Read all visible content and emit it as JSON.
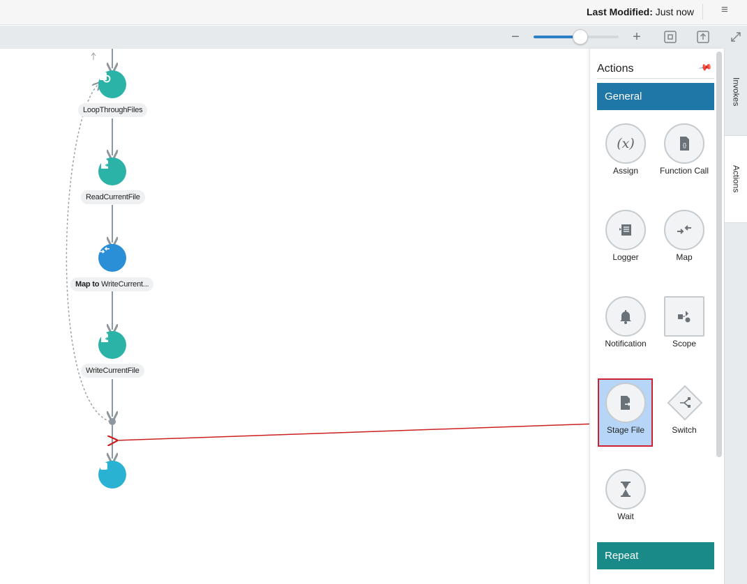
{
  "header": {
    "last_modified_label": "Last Modified:",
    "last_modified_value": "Just now"
  },
  "icons": {
    "menu": "hamburger-menu-icon",
    "zoom_out": "minus-icon",
    "zoom_in": "plus-icon",
    "fit": "fit-to-screen-icon",
    "reset": "reset-view-icon",
    "expand": "expand-icon"
  },
  "zoom": {
    "level_fraction": 0.55
  },
  "flow": {
    "nodes": [
      {
        "label_bold": "",
        "label": "LoopThroughFiles",
        "icon": "loop-icon",
        "color": "#2bb3a8"
      },
      {
        "label_bold": "",
        "label": "ReadCurrentFile",
        "icon": "file-icon",
        "color": "#2bb3a8"
      },
      {
        "label_bold": "Map to",
        "label": " WriteCurrent...",
        "icon": "map-icon",
        "color": "#2a8fd6"
      },
      {
        "label_bold": "",
        "label": "WriteCurrentFile",
        "icon": "file-icon",
        "color": "#2bb3a8"
      }
    ],
    "end_icon": "stop-icon"
  },
  "palette": {
    "title": "Actions",
    "general_label": "General",
    "repeat_label": "Repeat",
    "actions": [
      {
        "label": "Assign",
        "icon": "variable-x-icon",
        "glyph": "(x)"
      },
      {
        "label": "Function Call",
        "icon": "function-file-icon",
        "glyph": "{}"
      },
      {
        "label": "Logger",
        "icon": "logger-icon",
        "glyph": "≡"
      },
      {
        "label": "Map",
        "icon": "map-arrows-icon",
        "glyph": "⇄"
      },
      {
        "label": "Notification",
        "icon": "bell-icon",
        "glyph": "🔔"
      },
      {
        "label": "Scope",
        "icon": "scope-icon",
        "glyph": "▪"
      },
      {
        "label": "Stage File",
        "icon": "stage-file-icon",
        "glyph": "▤"
      },
      {
        "label": "Switch",
        "icon": "switch-icon",
        "glyph": "⋔"
      },
      {
        "label": "Wait",
        "icon": "hourglass-icon",
        "glyph": "⌛"
      }
    ]
  },
  "side_tabs": {
    "invokes": "Invokes",
    "actions": "Actions"
  },
  "colors": {
    "accent_blue": "#1f77a8",
    "repeat_teal": "#1a8a88",
    "node_teal": "#2bb3a8",
    "map_blue": "#2a8fd6",
    "highlight_red": "#cc2131",
    "arrow_red": "#cc1f1f"
  }
}
